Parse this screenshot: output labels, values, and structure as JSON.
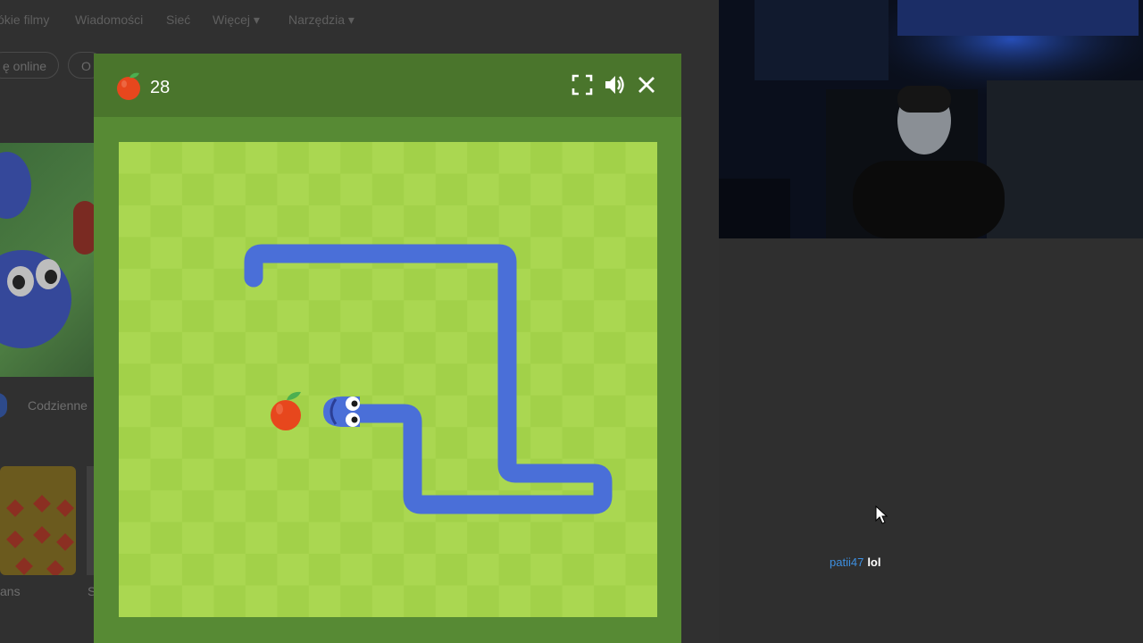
{
  "background_browser": {
    "nav_items": [
      "ókie filmy",
      "Wiadomości",
      "Sieć",
      "Więcej ▾",
      "Narzędzia ▾"
    ],
    "chips": [
      "ę online",
      "O"
    ],
    "daily_label": "Codzienne",
    "card_caption_left": "ans",
    "card_caption_right": "S"
  },
  "game": {
    "score": "28",
    "icons": {
      "score": "apple-icon",
      "fullscreen": "fullscreen-icon",
      "sound": "speaker-icon",
      "close": "close-icon"
    },
    "colors": {
      "frame": "#578a34",
      "header": "#4a752c",
      "board_light": "#aad751",
      "board_dark": "#a2d149",
      "snake": "#4a6fd8",
      "apple": "#e7471d"
    },
    "grid": {
      "cols": 17,
      "rows": 15
    }
  },
  "chat": {
    "username": "patii47",
    "message": "lol"
  }
}
